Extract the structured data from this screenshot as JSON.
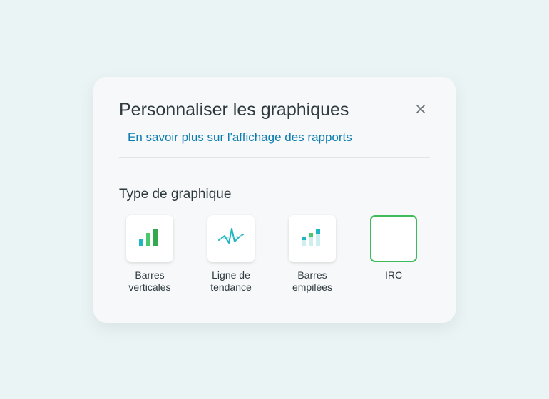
{
  "dialog": {
    "title": "Personnaliser les graphiques",
    "learn_more": "En savoir plus sur l'affichage des rapports",
    "section_label": "Type de graphique",
    "chart_types": [
      {
        "label": "Barres verticales",
        "selected": false,
        "icon": "vertical-bars-icon"
      },
      {
        "label": "Ligne de tendance",
        "selected": false,
        "icon": "trend-line-icon"
      },
      {
        "label": "Barres empilées",
        "selected": false,
        "icon": "stacked-bars-icon"
      },
      {
        "label": "IRC",
        "selected": true,
        "icon": "irc-icon"
      }
    ]
  }
}
